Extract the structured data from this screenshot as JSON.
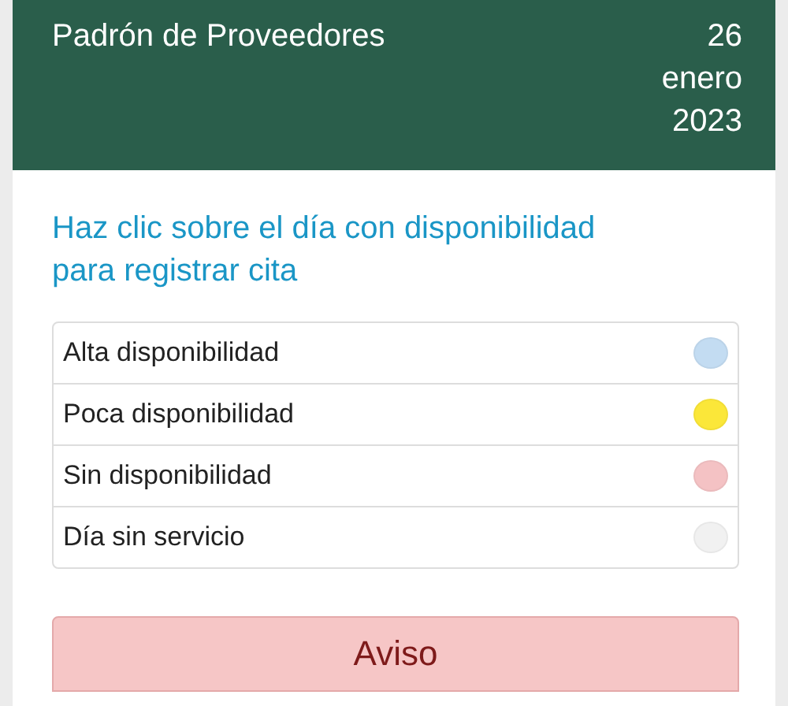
{
  "header": {
    "title": "Padrón de Proveedores",
    "date": [
      "26",
      "enero",
      "2023"
    ]
  },
  "instructions": "Haz clic sobre el día con disponibilidad para registrar cita",
  "legend": [
    {
      "label": "Alta disponibilidad",
      "color": "#c3dcf2"
    },
    {
      "label": "Poca disponibilidad",
      "color": "#fbe739"
    },
    {
      "label": "Sin disponibilidad",
      "color": "#f4c2c4"
    },
    {
      "label": "Día sin servicio",
      "color": "#f1f1f1"
    }
  ],
  "notice": {
    "title": "Aviso"
  }
}
